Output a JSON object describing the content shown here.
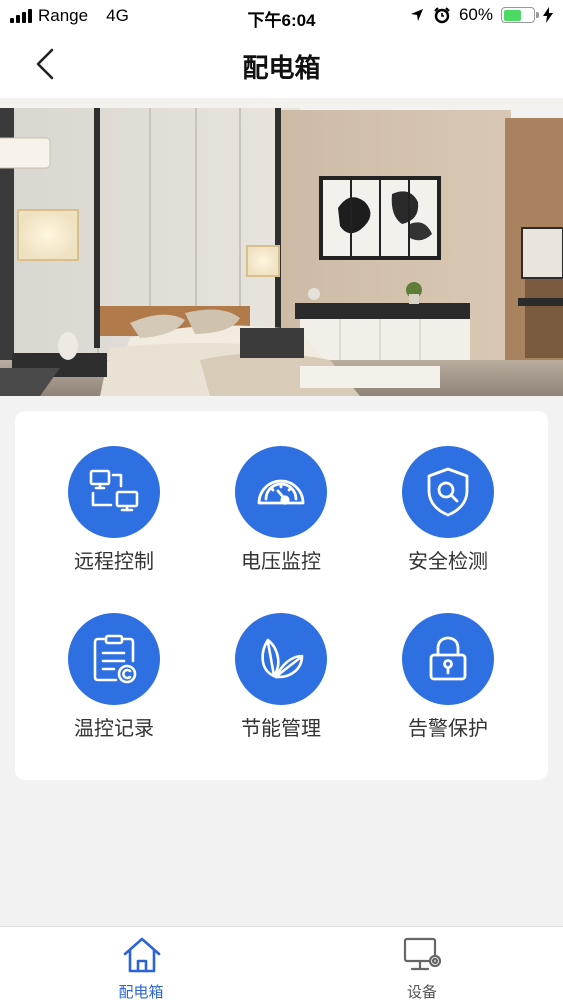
{
  "status_bar": {
    "carrier": "Range",
    "network": "4G",
    "time": "下午6:04",
    "battery": "60%",
    "battery_level": 0.6
  },
  "header": {
    "title": "配电箱"
  },
  "menu": {
    "items": [
      {
        "label": "远程控制",
        "icon": "remote-control-icon"
      },
      {
        "label": "电压监控",
        "icon": "voltage-gauge-icon"
      },
      {
        "label": "安全检测",
        "icon": "shield-search-icon"
      },
      {
        "label": "温控记录",
        "icon": "document-record-icon"
      },
      {
        "label": "节能管理",
        "icon": "leaf-icon"
      },
      {
        "label": "告警保护",
        "icon": "lock-icon"
      }
    ]
  },
  "tab_bar": {
    "tabs": [
      {
        "label": "配电箱",
        "icon": "home-icon",
        "active": true
      },
      {
        "label": "设备",
        "icon": "device-settings-icon",
        "active": false
      }
    ]
  },
  "colors": {
    "accent": "#2e6fe2",
    "active_tab": "#2a64d8",
    "inactive_tab": "#555555",
    "battery": "#4cd964"
  }
}
